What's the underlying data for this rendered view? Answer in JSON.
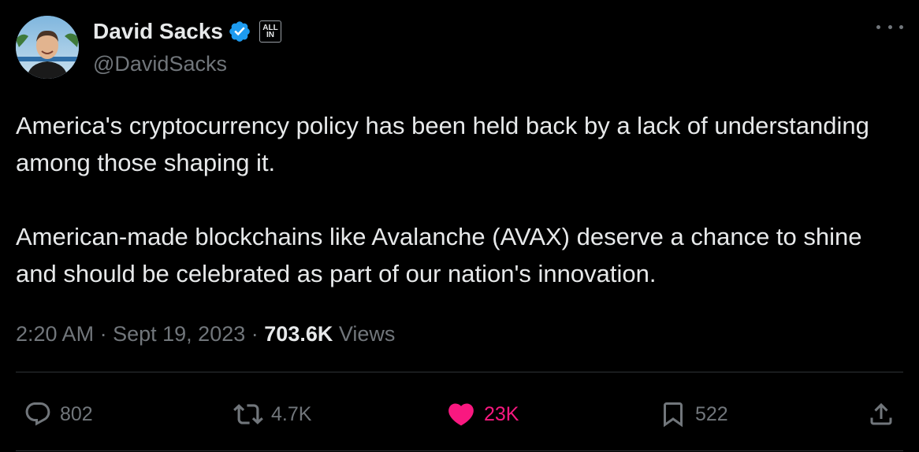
{
  "author": {
    "name": "David Sacks",
    "handle": "@DavidSacks",
    "affiliate_badge": "ALL IN",
    "avatar_icon": "avatar-photo",
    "verified_color": "#1d9bf0"
  },
  "tweet": {
    "paragraphs": [
      "America's cryptocurrency policy has been held back by a lack of understanding among those shaping it.",
      "American-made blockchains like Avalanche (AVAX) deserve a chance to shine and should be celebrated as part of our nation's innovation."
    ]
  },
  "meta": {
    "time": "2:20 AM",
    "separator": "·",
    "date": "Sept 19, 2023",
    "views_count": "703.6K",
    "views_label": "Views"
  },
  "actions": {
    "reply": {
      "icon": "reply-icon",
      "count": "802"
    },
    "retweet": {
      "icon": "retweet-icon",
      "count": "4.7K"
    },
    "like": {
      "icon": "heart-icon",
      "count": "23K",
      "color": "#f91880"
    },
    "bookmark": {
      "icon": "bookmark-icon",
      "count": "522"
    },
    "share": {
      "icon": "share-icon"
    }
  },
  "colors": {
    "background": "#000000",
    "text": "#e7e9ea",
    "secondary": "#71767b",
    "divider": "#2f3336"
  }
}
